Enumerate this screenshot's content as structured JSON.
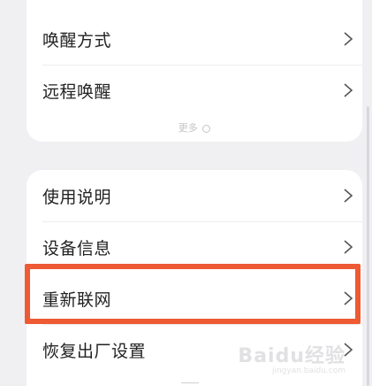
{
  "top_section": {
    "items": [
      {
        "label": "唤醒方式"
      },
      {
        "label": "远程唤醒"
      }
    ],
    "more_label": "更多"
  },
  "bottom_section": {
    "items": [
      {
        "label": "使用说明"
      },
      {
        "label": "设备信息"
      },
      {
        "label": "重新联网"
      },
      {
        "label": "恢复出厂设置"
      }
    ]
  },
  "highlighted_item": "重新联网",
  "watermark": {
    "text": "Baidu经验",
    "sub": "jingyan.baidu.com"
  },
  "colors": {
    "highlight": "#ee5a33",
    "background": "#f0f0f3",
    "card": "#ffffff"
  }
}
